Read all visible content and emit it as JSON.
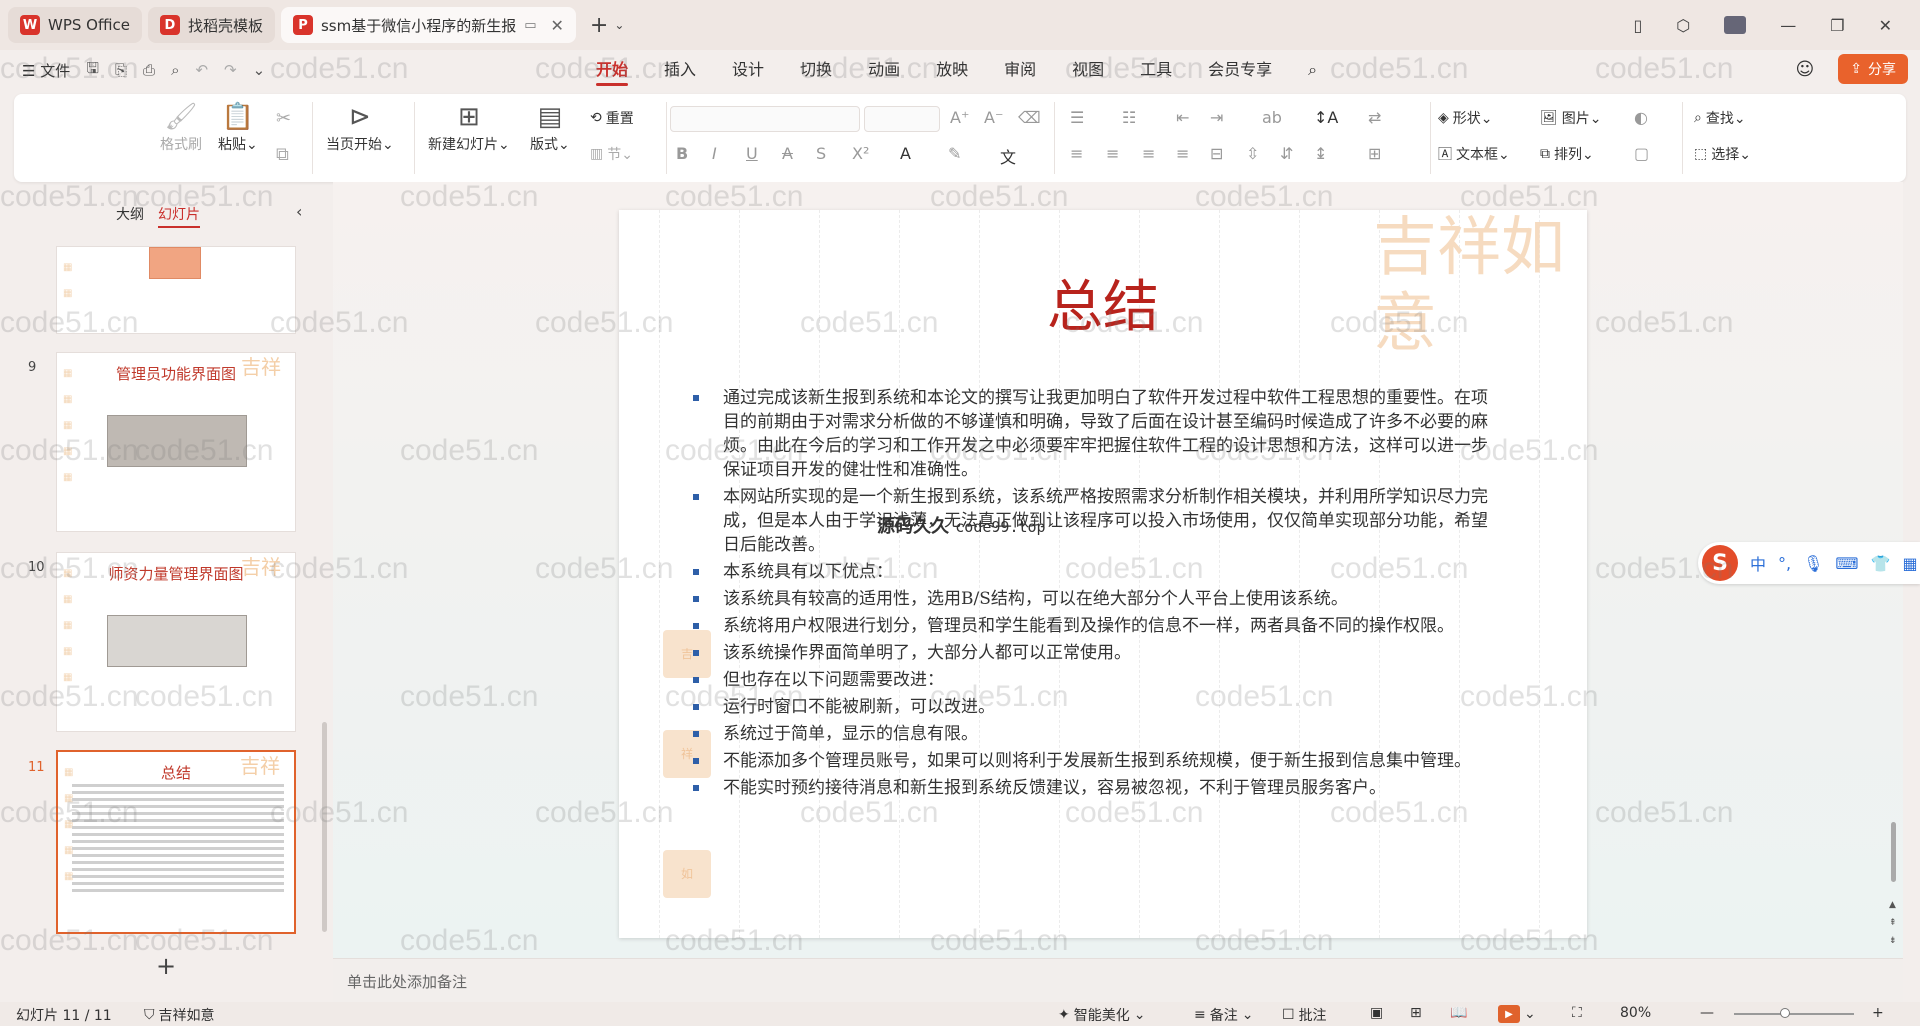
{
  "titlebar": {
    "tabs": [
      {
        "label": "WPS Office",
        "icon": "W",
        "icon_color": "#d9342b"
      },
      {
        "label": "找稻壳模板",
        "icon": "D",
        "icon_color": "#d9342b"
      },
      {
        "label": "ssm基于微信小程序的新生报",
        "icon": "P",
        "icon_color": "#d9342b"
      }
    ],
    "new_tab": "+"
  },
  "menu": {
    "file": "文件",
    "tabs": [
      "开始",
      "插入",
      "设计",
      "切换",
      "动画",
      "放映",
      "审阅",
      "视图",
      "工具",
      "会员专享"
    ],
    "active_tab": "开始",
    "share": "分享"
  },
  "ribbon": {
    "format_painter": "格式刷",
    "paste": "粘贴",
    "play_current": "当页开始",
    "new_slide": "新建幻灯片",
    "layout": "版式",
    "reset": "重置",
    "section": "节",
    "shape": "形状",
    "picture": "图片",
    "textbox": "文本框",
    "arrange": "排列",
    "find": "查找",
    "select": "选择"
  },
  "leftpane": {
    "tab_outline": "大纲",
    "tab_slides": "幻灯片",
    "thumbs": [
      {
        "num": "9",
        "title": "管理员功能界面图"
      },
      {
        "num": "10",
        "title": "师资力量管理界面图"
      },
      {
        "num": "11",
        "title": "总结"
      }
    ]
  },
  "slide": {
    "title": "总结",
    "bullets": [
      "通过完成该新生报到系统和本论文的撰写让我更加明白了软件开发过程中软件工程思想的重要性。在项目的前期由于对需求分析做的不够谨慎和明确，导致了后面在设计甚至编码时候造成了许多不必要的麻烦。由此在今后的学习和工作开发之中必须要牢牢把握住软件工程的设计思想和方法，这样可以进一步保证项目开发的健壮性和准确性。",
      "本网站所实现的是一个新生报到系统，该系统严格按照需求分析制作相关模块，并利用所学知识尽力完成，但是本人由于学识浅薄，无法真正做到让该程序可以投入市场使用，仅仅简单实现部分功能，希望日后能改善。",
      "本系统具有以下优点：",
      "该系统具有较高的适用性，选用B/S结构，可以在绝大部分个人平台上使用该系统。",
      "系统将用户权限进行划分，管理员和学生能看到及操作的信息不一样，两者具备不同的操作权限。",
      "该系统操作界面简单明了，大部分人都可以正常使用。",
      "但也存在以下问题需要改进：",
      "运行时窗口不能被刷新，可以改进。",
      "系统过于简单，显示的信息有限。",
      "不能添加多个管理员账号，如果可以则将利于发展新生报到系统规模，便于新生报到信息集中管理。",
      "不能实时预约接待消息和新生报到系统反馈建议，容易被忽视，不利于管理员服务客户。"
    ],
    "overlay_label": "源码久久",
    "overlay_url": "code99.top",
    "deco_text": "吉祥如意"
  },
  "notes": {
    "placeholder": "单击此处添加备注"
  },
  "ime": {
    "lang": "中"
  },
  "status": {
    "slide_counter": "幻灯片 11 / 11",
    "theme": "吉祥如意",
    "smart": "智能美化",
    "notes": "备注",
    "comment": "批注",
    "zoom": "80%"
  },
  "watermark": "code51.cn"
}
